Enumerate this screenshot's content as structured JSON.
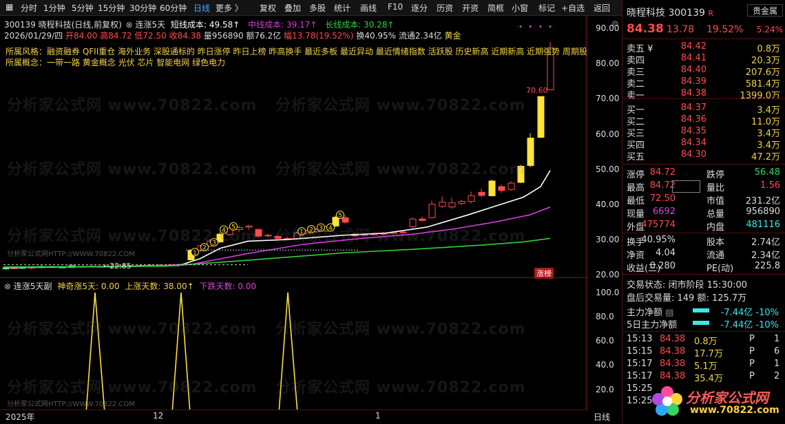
{
  "toolbar": {
    "left_items": [
      "分时",
      "1分钟",
      "5分钟",
      "15分钟",
      "30分钟",
      "60分钟",
      "日线",
      "更多 〉"
    ],
    "active": "日线",
    "right_items": [
      "复权",
      "叠加",
      "多股",
      "统计",
      "画线",
      "F10",
      "逐分",
      "历资",
      "开资",
      "简框",
      "小窗",
      "标记",
      "+自选",
      "返回"
    ]
  },
  "main_panel": {
    "indicator_line": {
      "code_name": "300139 晓程科技(日线,前复权)",
      "indicator": "连涨5天",
      "short_cost_label": "短线成本: 49.58↑",
      "mid_cost_label": "中线成本: 39.17↑",
      "long_cost_label": "长线成本: 30.28↑"
    },
    "ohlc_line": {
      "date": "2026/01/29/四",
      "open": "开84.00",
      "high": "高84.72",
      "low": "低72.50",
      "close": "收84.38",
      "volume": "量956890",
      "amount": "额76.2亿",
      "change": "幅13.78(19.52%)",
      "turnover": "换40.95%",
      "float": "流通2.34亿",
      "tag": "黄金"
    },
    "concepts_line1": "所属风格：融资融券  QFII重仓  海外业务  深股通标的  昨日涨停  昨日上榜  昨高换手  最近多板  最近异动  最近情绪指数  活跃股  历史新高  近期新高  近期强势  周期股",
    "concepts_line2": "所属概念：一带一路  黄金概念  光伏  芯片  智能电网  绿色电力",
    "price_label_high": "70.60",
    "price_label_low": "←22.85",
    "badge": "涨榜",
    "watermark_small": "分析家公式网HTTP://WWW.70822.COM",
    "y_ticks": [
      "90.00",
      "80.00",
      "70.00",
      "60.00",
      "50.00",
      "40.00",
      "30.00",
      "20.00"
    ]
  },
  "sub_panel": {
    "indicator": "连涨5天副",
    "magic_label": "神奇涨5天: 0.00",
    "up_days_label": "上涨天数: 38.00↑",
    "down_days_label": "下跌天数: 0.00",
    "y_ticks": [
      "100.0",
      "80.0",
      "60.0",
      "40.0",
      "20.0"
    ],
    "x_labels": [
      "2025年",
      "12",
      "1"
    ],
    "period": "日线",
    "watermark_small": "分析家公式网HTTP://WWW.70822.COM"
  },
  "watermark": "分析家公式网 www.70822.com",
  "quote": {
    "name": "晓程科技",
    "code": "300139",
    "r_badge": "R",
    "sector": "贵金属",
    "price": "84.38",
    "change": "13.78",
    "change_pct": "19.52%",
    "sector_pct": "5.24%",
    "asks": [
      {
        "label": "卖五 ¥",
        "price": "84.42",
        "vol": "0.8万"
      },
      {
        "label": "卖四",
        "price": "84.41",
        "vol": "20.3万"
      },
      {
        "label": "卖三",
        "price": "84.40",
        "vol": "207.6万"
      },
      {
        "label": "卖二",
        "price": "84.39",
        "vol": "581.4万"
      },
      {
        "label": "卖一",
        "price": "84.38",
        "vol": "1399.0万"
      }
    ],
    "bids": [
      {
        "label": "买一",
        "price": "84.37",
        "vol": "3.4万"
      },
      {
        "label": "买二",
        "price": "84.36",
        "vol": "11.0万"
      },
      {
        "label": "买三",
        "price": "84.35",
        "vol": "3.4万"
      },
      {
        "label": "买四",
        "price": "84.34",
        "vol": "3.4万"
      },
      {
        "label": "买五",
        "price": "84.30",
        "vol": "47.2万"
      }
    ],
    "stats": [
      {
        "k1": "涨停",
        "v1": "84.72",
        "k2": "跌停",
        "v2": "56.48"
      },
      {
        "k1": "最高",
        "v1": "84.72",
        "k2": "量比",
        "v2": "1.56"
      },
      {
        "k1": "最低",
        "v1": "72.50",
        "k2": "市值",
        "v2": "231.2亿"
      },
      {
        "k1": "现量",
        "v1": "6692",
        "k2": "总量",
        "v2": "956890"
      },
      {
        "k1": "外盘",
        "v1": "475774",
        "k2": "内盘",
        "v2": "481116"
      }
    ],
    "stats2": [
      {
        "k1": "换手",
        "v1": "40.95%",
        "k2": "股本",
        "v2": "2.74亿"
      },
      {
        "k1": "净资",
        "v1": "4.04",
        "k2": "流通",
        "v2": "2.34亿"
      },
      {
        "k1": "收益(三)",
        "v1": "0.280",
        "k2": "PE(动)",
        "v2": "225.8"
      }
    ],
    "status": "交易状态: 闭市阶段 15:30:00",
    "after_hours": "盘后交易量: 149  额: 125.7万",
    "main_flow_label": "主力净额",
    "main_flow_value": "-7.44亿 -10%",
    "five_day_label": "5日主力净额",
    "five_day_value": "-7.44亿 -10%",
    "ticks": [
      {
        "t": "15:13",
        "p": "84.38",
        "v": "0.8万",
        "f": "P",
        "n": "1"
      },
      {
        "t": "15:15",
        "p": "84.38",
        "v": "17.7万",
        "f": "P",
        "n": "6"
      },
      {
        "t": "15:17",
        "p": "84.38",
        "v": "5.1万",
        "f": "P",
        "n": "1"
      },
      {
        "t": "15:17",
        "p": "84.38",
        "v": "35.4万",
        "f": "P",
        "n": "2"
      },
      {
        "t": "15:25",
        "p": "",
        "v": "",
        "f": "",
        "n": ""
      },
      {
        "t": "15:25",
        "p": "",
        "v": "",
        "f": "",
        "n": ""
      }
    ],
    "logo_text": "分析家公式网",
    "logo_url": "www.70822.com"
  },
  "colors": {
    "up": "#ff4b4b",
    "down": "#36d76c",
    "short_ma": "#ffffff",
    "mid_ma": "#d63be0",
    "long_ma": "#2fd23a",
    "yellow": "#ffe23a"
  }
}
